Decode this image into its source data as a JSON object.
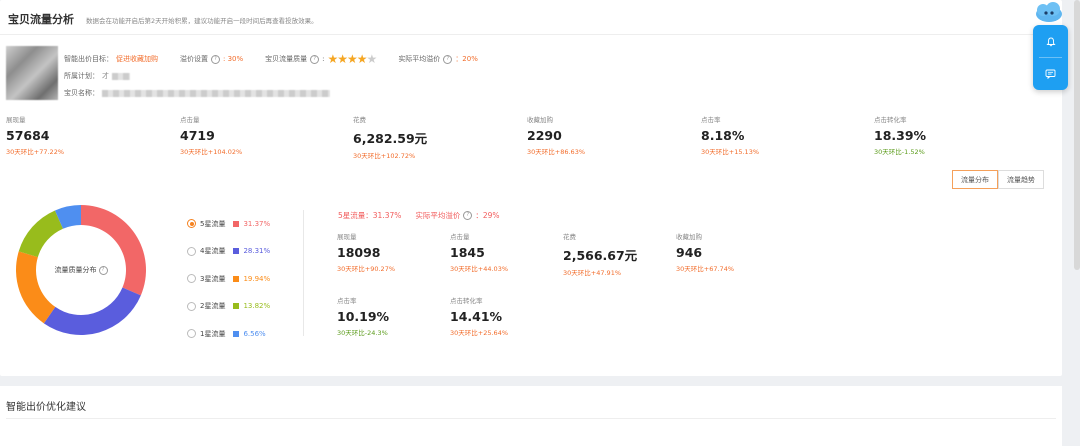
{
  "header": {
    "title": "宝贝流量分析",
    "tip": "数据会在功能开启后第2天开始积累，建议功能开启一段时间后再查看投放效果。"
  },
  "product": {
    "goal_label": "智能出价目标：",
    "goal_value": "促进收藏加购",
    "premium_label": "溢价设置",
    "premium_value": ": 30%",
    "quality_label": "宝贝流量质量",
    "quality_stars": 4,
    "avg_premium_label": "实际平均溢价",
    "avg_premium_value": "：20%",
    "plan_label": "所属计划：",
    "plan_value": "才",
    "name_label": "宝贝名称："
  },
  "metrics": [
    {
      "label": "展现量",
      "value": "57684",
      "change": "30天环比+77.22%",
      "trend": "up"
    },
    {
      "label": "点击量",
      "value": "4719",
      "change": "30天环比+104.02%",
      "trend": "up"
    },
    {
      "label": "花费",
      "value": "6,282.59元",
      "change": "30天环比+102.72%",
      "trend": "up"
    },
    {
      "label": "收藏加购",
      "value": "2290",
      "change": "30天环比+86.63%",
      "trend": "up"
    },
    {
      "label": "点击率",
      "value": "8.18%",
      "change": "30天环比+15.13%",
      "trend": "up"
    },
    {
      "label": "点击转化率",
      "value": "18.39%",
      "change": "30天环比-1.52%",
      "trend": "down"
    }
  ],
  "tabs": {
    "distribution": "流量分布",
    "trend": "流量趋势"
  },
  "donut": {
    "center_label": "流量质量分布",
    "slices": [
      {
        "name": "5星流量",
        "pct": 31.37,
        "pct_label": "31.37%",
        "color": "#f26767"
      },
      {
        "name": "4星流量",
        "pct": 28.31,
        "pct_label": "28.31%",
        "color": "#5a5ddd"
      },
      {
        "name": "3星流量",
        "pct": 19.94,
        "pct_label": "19.94%",
        "color": "#fb8c18"
      },
      {
        "name": "2星流量",
        "pct": 13.82,
        "pct_label": "13.82%",
        "color": "#98bc1c"
      },
      {
        "name": "1星流量",
        "pct": 6.56,
        "pct_label": "6.56%",
        "color": "#4f8ff0"
      }
    ],
    "selected": "5星流量"
  },
  "detail": {
    "flow_label": "5星流量：31.37%",
    "avg_label": "实际平均溢价",
    "avg_value": "：29%",
    "metrics": [
      {
        "label": "展现量",
        "value": "18098",
        "change": "30天环比+90.27%",
        "trend": "up"
      },
      {
        "label": "点击量",
        "value": "1845",
        "change": "30天环比+44.03%",
        "trend": "up"
      },
      {
        "label": "花费",
        "value": "2,566.67元",
        "change": "30天环比+47.91%",
        "trend": "up"
      },
      {
        "label": "收藏加购",
        "value": "946",
        "change": "30天环比+67.74%",
        "trend": "up"
      },
      {
        "label": "点击率",
        "value": "10.19%",
        "change": "30天环比-24.3%",
        "trend": "down"
      },
      {
        "label": "点击转化率",
        "value": "14.41%",
        "change": "30天环比+25.64%",
        "trend": "up"
      }
    ]
  },
  "section2": {
    "title": "智能出价优化建议"
  },
  "floating": {
    "bell_icon": "bell-icon",
    "chat_icon": "chat-icon"
  }
}
